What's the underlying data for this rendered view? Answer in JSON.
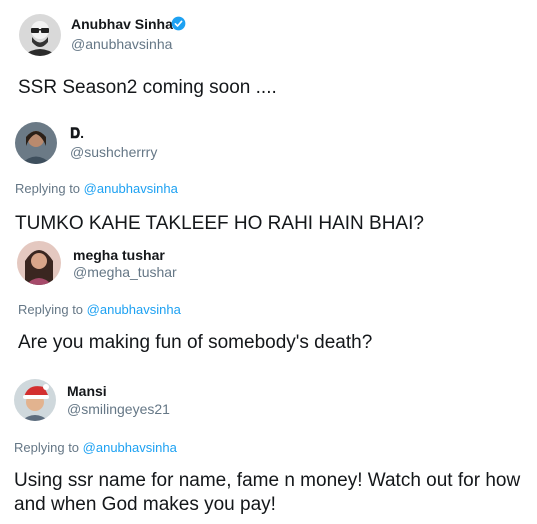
{
  "tweets": [
    {
      "name": "Anubhav Sinha",
      "handle": "@anubhavsinha",
      "verified": true,
      "text": "SSR Season2 coming soon ...."
    },
    {
      "name": "𝐃.",
      "handle": "@sushcherrry",
      "reply_prefix": "Replying to",
      "reply_to": "@anubhavsinha",
      "text": "TUMKO KAHE TAKLEEF HO RAHI HAIN BHAI?"
    },
    {
      "name": "megha tushar",
      "handle": "@megha_tushar",
      "reply_prefix": "Replying to",
      "reply_to": "@anubhavsinha",
      "text": "Are you making fun of somebody's death?"
    },
    {
      "name": "Mansi",
      "handle": "@smilingeyes21",
      "reply_prefix": "Replying to",
      "reply_to": "@anubhavsinha",
      "text": "Using ssr name for name, fame n money! Watch out for how and when God makes you pay!"
    }
  ],
  "colors": {
    "text": "#14171a",
    "secondary": "#657786",
    "link": "#1da1f2",
    "verified": "#1da1f2"
  },
  "icons": {
    "verified": "verified-badge-icon"
  }
}
